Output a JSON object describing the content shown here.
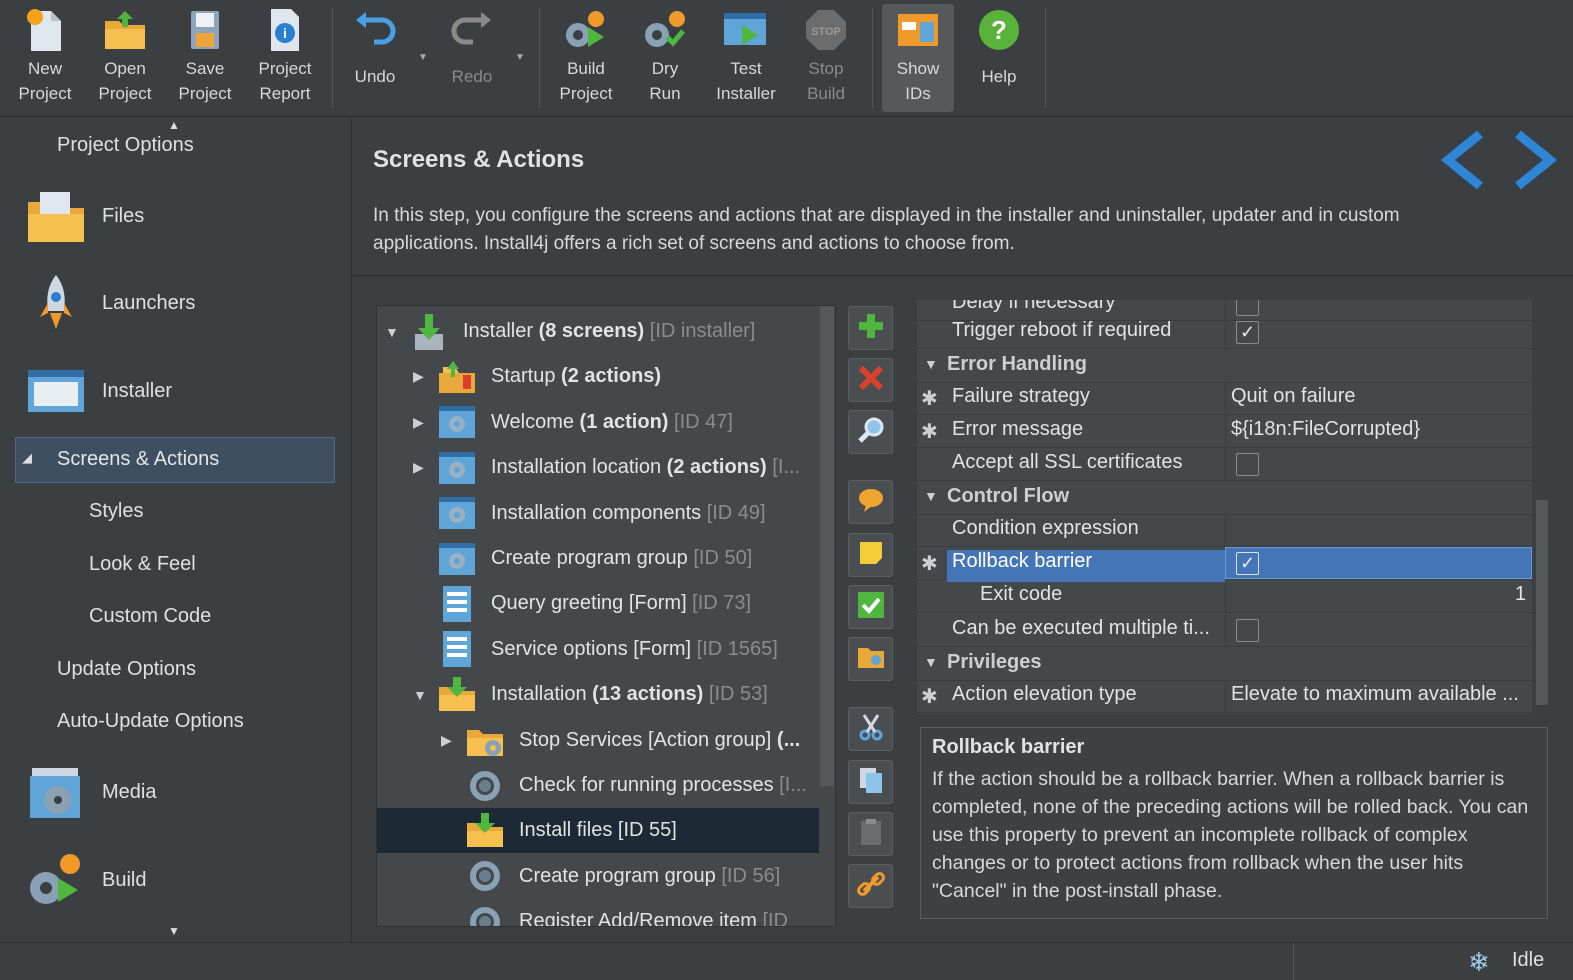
{
  "toolbar": {
    "new_project": "New\nProject",
    "open_project": "Open\nProject",
    "save_project": "Save\nProject",
    "project_report": "Project\nReport",
    "undo": "Undo",
    "redo": "Redo",
    "build_project": "Build\nProject",
    "dry_run": "Dry\nRun",
    "test_installer": "Test\nInstaller",
    "stop_build": "Stop\nBuild",
    "show_ids": "Show\nIDs",
    "help": "Help"
  },
  "sidebar": {
    "project_options": "Project Options",
    "files": "Files",
    "launchers": "Launchers",
    "installer": "Installer",
    "screens_actions": "Screens & Actions",
    "styles": "Styles",
    "look_feel": "Look & Feel",
    "custom_code": "Custom Code",
    "update_options": "Update Options",
    "auto_update_options": "Auto-Update Options",
    "media": "Media",
    "build": "Build"
  },
  "header": {
    "title": "Screens & Actions",
    "description": "In this step, you configure the screens and actions that are displayed in the installer and uninstaller, updater and in custom applications. Install4j offers a rich set of screens and actions to choose from."
  },
  "tree": [
    {
      "name": "Installer ",
      "bold": "(8 screens)",
      "id": " [ID installer]"
    },
    {
      "name": "Startup ",
      "bold": "(2 actions)",
      "id": ""
    },
    {
      "name": "Welcome ",
      "bold": "(1 action)",
      "id": " [ID 47]"
    },
    {
      "name": "Installation location ",
      "bold": "(2 actions)",
      "id": " [I..."
    },
    {
      "name": "Installation components",
      "bold": "",
      "id": " [ID 49]"
    },
    {
      "name": "Create program group",
      "bold": "",
      "id": " [ID 50]"
    },
    {
      "name": "Query greeting [Form]",
      "bold": "",
      "id": " [ID 73]"
    },
    {
      "name": "Service options [Form]",
      "bold": "",
      "id": " [ID 1565]"
    },
    {
      "name": "Installation ",
      "bold": "(13 actions)",
      "id": " [ID 53]"
    },
    {
      "name": "Stop Services [Action group] ",
      "bold": "(...",
      "id": ""
    },
    {
      "name": "Check for running processes",
      "bold": "",
      "id": " [I..."
    },
    {
      "name": "Install files [ID 55]",
      "bold": "",
      "id": ""
    },
    {
      "name": "Create program group",
      "bold": "",
      "id": " [ID 56]"
    },
    {
      "name": "Register Add/Remove item",
      "bold": "",
      "id": " [ID"
    }
  ],
  "props": {
    "delay": "Delay if necessary",
    "trigger_reboot": "Trigger reboot if required",
    "sect_error": "Error Handling",
    "failure_strategy": "Failure strategy",
    "failure_strategy_val": "Quit on failure",
    "error_message": "Error message",
    "error_message_val": "${i18n:FileCorrupted}",
    "accept_ssl": "Accept all SSL certificates",
    "sect_control": "Control Flow",
    "condition": "Condition expression",
    "rollback": "Rollback barrier",
    "exit_code": "Exit code",
    "exit_code_val": "1",
    "multiple": "Can be executed multiple ti...",
    "sect_priv": "Privileges",
    "elevation": "Action elevation type",
    "elevation_val": "Elevate to maximum available ..."
  },
  "help": {
    "title": "Rollback barrier",
    "body": "If the action should be a rollback barrier. When a rollback barrier is completed, none of the preceding actions will be rolled back. You can use this property to prevent an incomplete rollback of complex changes or to protect actions from rollback when the user hits \"Cancel\" in the post-install phase."
  },
  "status": {
    "text": "Idle"
  }
}
